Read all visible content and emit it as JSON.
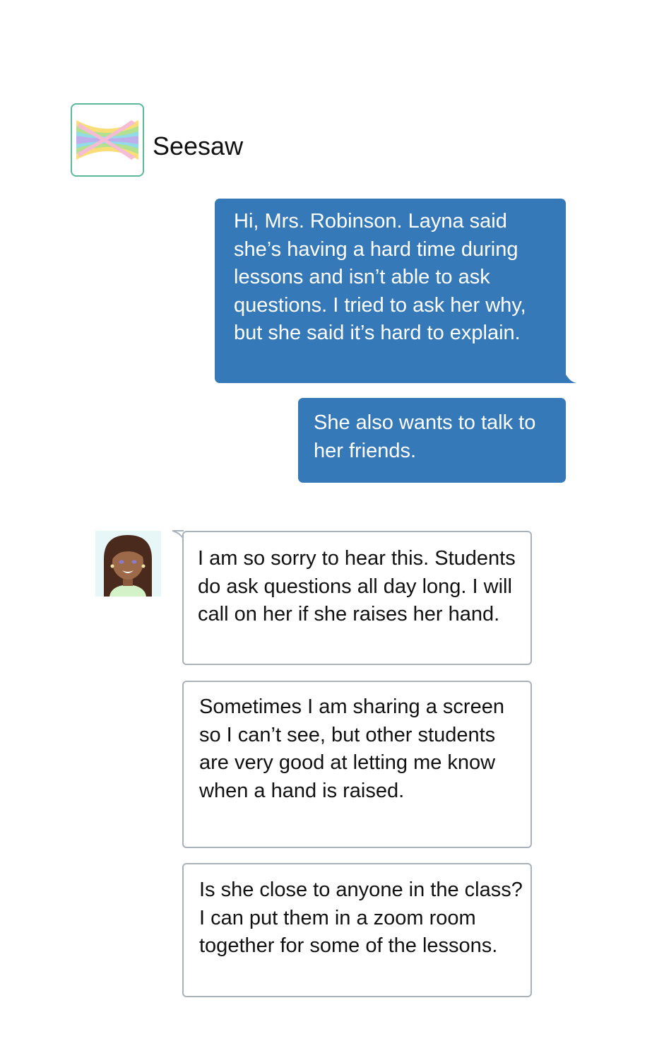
{
  "app": {
    "name": "Seesaw",
    "logo_icon": "seesaw-logo-icon",
    "colors": {
      "logo_border": "#5bb89a",
      "outgoing_bubble": "#3579b8",
      "incoming_border": "#a9b1bb"
    }
  },
  "conversation": {
    "outgoing": [
      {
        "text": "Hi, Mrs. Robinson. Layna said she’s having a hard time during lessons and isn’t able to ask questions. I tried to ask her why, but she said it’s hard to explain."
      },
      {
        "text": "She also wants to talk to her friends."
      }
    ],
    "incoming": {
      "avatar_icon": "teacher-avatar-icon",
      "messages": [
        {
          "text": "I am so sorry to hear this. Students do ask questions all day long. I will call on her if she raises her hand."
        },
        {
          "text": "Sometimes I am sharing a screen so I can’t see, but other students are very good at letting me know when a hand is raised."
        },
        {
          "text": "Is she close to anyone in the class? I can put them in a zoom room together for some of the lessons."
        }
      ]
    }
  }
}
